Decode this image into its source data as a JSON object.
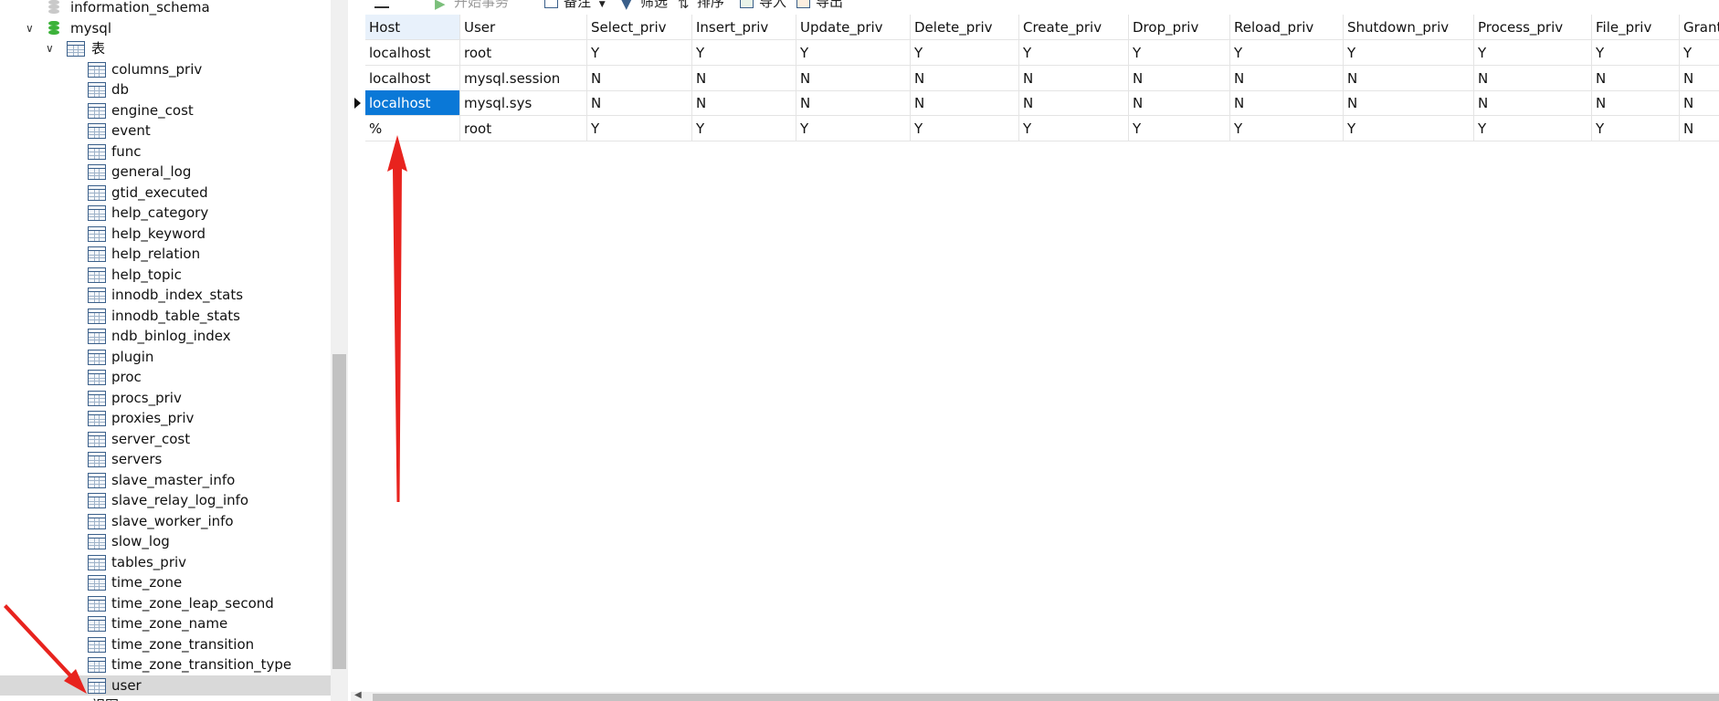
{
  "tree": {
    "databases": [
      {
        "name": "information_schema",
        "expanded": false
      },
      {
        "name": "mysql",
        "expanded": true,
        "group_label": "表"
      }
    ],
    "tables": [
      "columns_priv",
      "db",
      "engine_cost",
      "event",
      "func",
      "general_log",
      "gtid_executed",
      "help_category",
      "help_keyword",
      "help_relation",
      "help_topic",
      "innodb_index_stats",
      "innodb_table_stats",
      "ndb_binlog_index",
      "plugin",
      "proc",
      "procs_priv",
      "proxies_priv",
      "server_cost",
      "servers",
      "slave_master_info",
      "slave_relay_log_info",
      "slave_worker_info",
      "slow_log",
      "tables_priv",
      "time_zone",
      "time_zone_leap_second",
      "time_zone_name",
      "time_zone_transition",
      "time_zone_transition_type",
      "user"
    ],
    "selected_table": "user",
    "next_group_label": "视图"
  },
  "toolbar": {
    "menu_icon": "hamburger-icon",
    "begin_transaction": "开始事务",
    "notes": "备注",
    "filter": "筛选",
    "sort": "排序",
    "import": "导入",
    "export": "导出"
  },
  "grid": {
    "columns": [
      "Host",
      "User",
      "Select_priv",
      "Insert_priv",
      "Update_priv",
      "Delete_priv",
      "Create_priv",
      "Drop_priv",
      "Reload_priv",
      "Shutdown_priv",
      "Process_priv",
      "File_priv",
      "Grant"
    ],
    "rows": [
      [
        "localhost",
        "root",
        "Y",
        "Y",
        "Y",
        "Y",
        "Y",
        "Y",
        "Y",
        "Y",
        "Y",
        "Y",
        "Y"
      ],
      [
        "localhost",
        "mysql.session",
        "N",
        "N",
        "N",
        "N",
        "N",
        "N",
        "N",
        "N",
        "N",
        "N",
        "N"
      ],
      [
        "localhost",
        "mysql.sys",
        "N",
        "N",
        "N",
        "N",
        "N",
        "N",
        "N",
        "N",
        "N",
        "N",
        "N"
      ],
      [
        "%",
        "root",
        "Y",
        "Y",
        "Y",
        "Y",
        "Y",
        "Y",
        "Y",
        "Y",
        "Y",
        "Y",
        "N"
      ]
    ],
    "current_row": 2,
    "selected_cell": [
      2,
      0
    ]
  },
  "colors": {
    "selection": "#0a78d7",
    "tree_selected": "#d9d9d9",
    "annotation_arrow": "#e8231e",
    "db_icon": "#3cb23a"
  }
}
